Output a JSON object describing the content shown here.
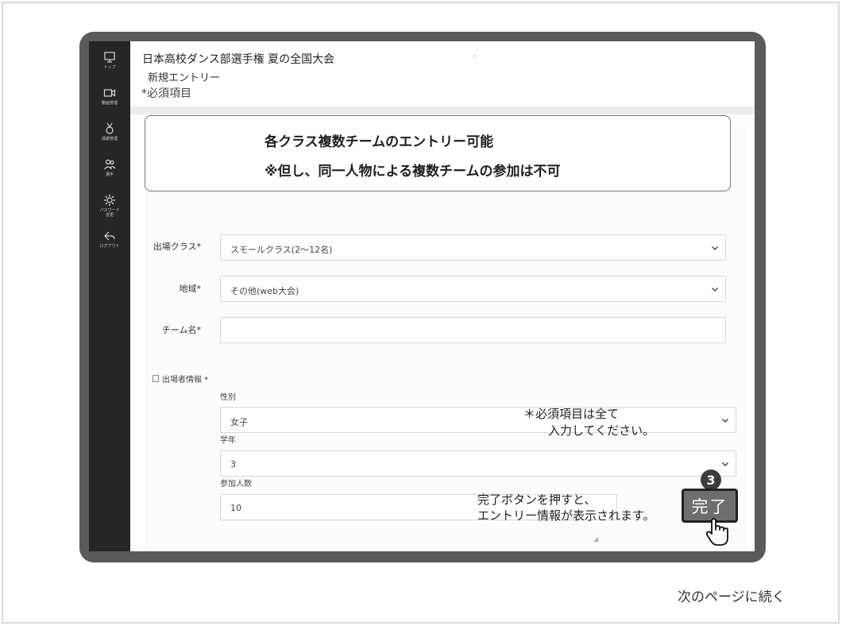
{
  "sidebar": {
    "items": [
      {
        "icon": "monitor-icon",
        "label": "トップ"
      },
      {
        "icon": "video-icon",
        "label": "動画管理"
      },
      {
        "icon": "medal-icon",
        "label": "成績管理"
      },
      {
        "icon": "users-icon",
        "label": "選手"
      },
      {
        "icon": "gear-icon",
        "label": "パスワード\n変更"
      },
      {
        "icon": "logout-icon",
        "label": "ログアウト"
      }
    ]
  },
  "header": {
    "title": "日本高校ダンス部選手権 夏の全国大会",
    "dot": "·",
    "subtitle": "新規エントリー",
    "required_note": "*必須項目"
  },
  "notice": {
    "line1": "各クラス複数チームのエントリー可能",
    "line2": "※但し、同一人物による複数チームの参加は不可"
  },
  "form": {
    "class_label": "出場クラス*",
    "class_value": "スモールクラス(2〜12名)",
    "region_label": "地域*",
    "region_value": "その他(web大会)",
    "team_label": "チーム名*",
    "team_value": "",
    "participant_label": "出場者情報 *",
    "gender_label": "性別",
    "gender_value": "女子",
    "grade_label": "学年",
    "grade_value": "3",
    "count_label": "参加人数",
    "count_value": "10"
  },
  "annotations": {
    "required_all_1": "＊必須項目は全て",
    "required_all_2": "入力してください。",
    "step_number": "3",
    "done_hint_1": "完了ボタンを押すと、",
    "done_hint_2": "エントリー情報が表示されます。",
    "done_button": "完了"
  },
  "footer": {
    "continue": "次のページに続く"
  }
}
